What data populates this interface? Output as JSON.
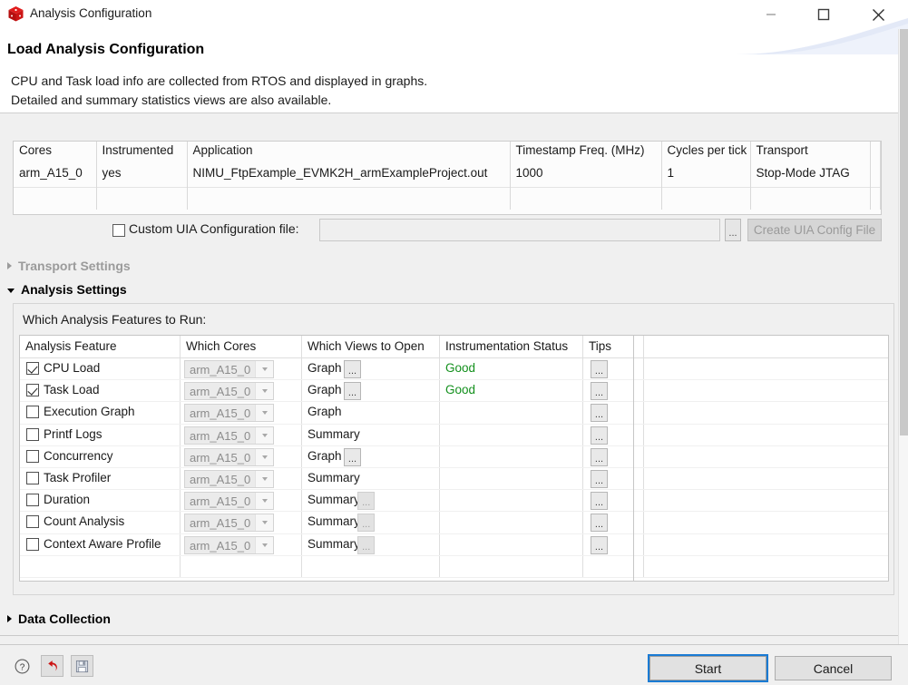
{
  "window": {
    "title": "Analysis Configuration",
    "app_icon": "red-cube-icon",
    "minimize_label": "—",
    "maximize_label": "□",
    "close_label": "✕"
  },
  "header": {
    "title": "Load Analysis Configuration",
    "desc_line1": "CPU and Task load info are collected from RTOS and displayed in graphs.",
    "desc_line2": "Detailed and summary statistics views are also available."
  },
  "info_table": {
    "columns": [
      "Cores",
      "Instrumented",
      "Application",
      "Timestamp Freq. (MHz)",
      "Cycles per tick",
      "Transport",
      ""
    ],
    "rows": [
      [
        "arm_A15_0",
        "yes",
        "NIMU_FtpExample_EVMK2H_armExampleProject.out",
        "1000",
        "1",
        "Stop-Mode JTAG",
        ""
      ]
    ]
  },
  "custom_uia": {
    "checkbox_checked": false,
    "label": "Custom UIA Configuration file:",
    "input_value": "",
    "input_placeholder": "",
    "browse_label": "...",
    "create_button_label": "Create UIA Config File",
    "create_button_enabled": false
  },
  "sections": {
    "transport_settings": {
      "label": "Transport Settings",
      "expanded": false,
      "enabled": false
    },
    "analysis_settings": {
      "label": "Analysis Settings",
      "expanded": true,
      "enabled": true
    },
    "data_collection": {
      "label": "Data Collection",
      "expanded": false,
      "enabled": true
    }
  },
  "analysis": {
    "prompt": "Which Analysis Features to Run:",
    "columns": [
      "Analysis Feature",
      "Which Cores",
      "Which Views to Open",
      "Instrumentation Status",
      "Tips"
    ],
    "rows": [
      {
        "feature": "CPU Load",
        "checked": true,
        "cores": "arm_A15_0",
        "view": "Graph",
        "view_dots": true,
        "view_dots_enabled": true,
        "status": "Good",
        "status_color": "#13901d",
        "tips": "..."
      },
      {
        "feature": "Task Load",
        "checked": true,
        "cores": "arm_A15_0",
        "view": "Graph",
        "view_dots": true,
        "view_dots_enabled": true,
        "status": "Good",
        "status_color": "#13901d",
        "tips": "..."
      },
      {
        "feature": "Execution Graph",
        "checked": false,
        "cores": "arm_A15_0",
        "view": "Graph",
        "view_dots": false,
        "view_dots_enabled": false,
        "status": "",
        "status_color": "#13901d",
        "tips": "..."
      },
      {
        "feature": "Printf Logs",
        "checked": false,
        "cores": "arm_A15_0",
        "view": "Summary",
        "view_dots": false,
        "view_dots_enabled": false,
        "status": "",
        "status_color": "#13901d",
        "tips": "..."
      },
      {
        "feature": "Concurrency",
        "checked": false,
        "cores": "arm_A15_0",
        "view": "Graph",
        "view_dots": true,
        "view_dots_enabled": true,
        "status": "",
        "status_color": "#13901d",
        "tips": "..."
      },
      {
        "feature": "Task Profiler",
        "checked": false,
        "cores": "arm_A15_0",
        "view": "Summary",
        "view_dots": false,
        "view_dots_enabled": false,
        "status": "",
        "status_color": "#13901d",
        "tips": "..."
      },
      {
        "feature": "Duration",
        "checked": false,
        "cores": "arm_A15_0",
        "view": "Summary",
        "view_dots": true,
        "view_dots_enabled": false,
        "status": "",
        "status_color": "#13901d",
        "tips": "..."
      },
      {
        "feature": "Count Analysis",
        "checked": false,
        "cores": "arm_A15_0",
        "view": "Summary",
        "view_dots": true,
        "view_dots_enabled": false,
        "status": "",
        "status_color": "#13901d",
        "tips": "..."
      },
      {
        "feature": "Context Aware Profile",
        "checked": false,
        "cores": "arm_A15_0",
        "view": "Summary",
        "view_dots": true,
        "view_dots_enabled": false,
        "status": "",
        "status_color": "#13901d",
        "tips": "..."
      }
    ]
  },
  "toolbar": {
    "help_icon": "question-mark-icon",
    "revert_icon": "revert-arrow-icon",
    "save_icon": "floppy-disk-icon"
  },
  "footer": {
    "start_label": "Start",
    "cancel_label": "Cancel",
    "start_focused": true
  },
  "colors": {
    "accent": "#1a7bd4",
    "status_good": "#13901d",
    "title_icon": "#cc0000"
  }
}
